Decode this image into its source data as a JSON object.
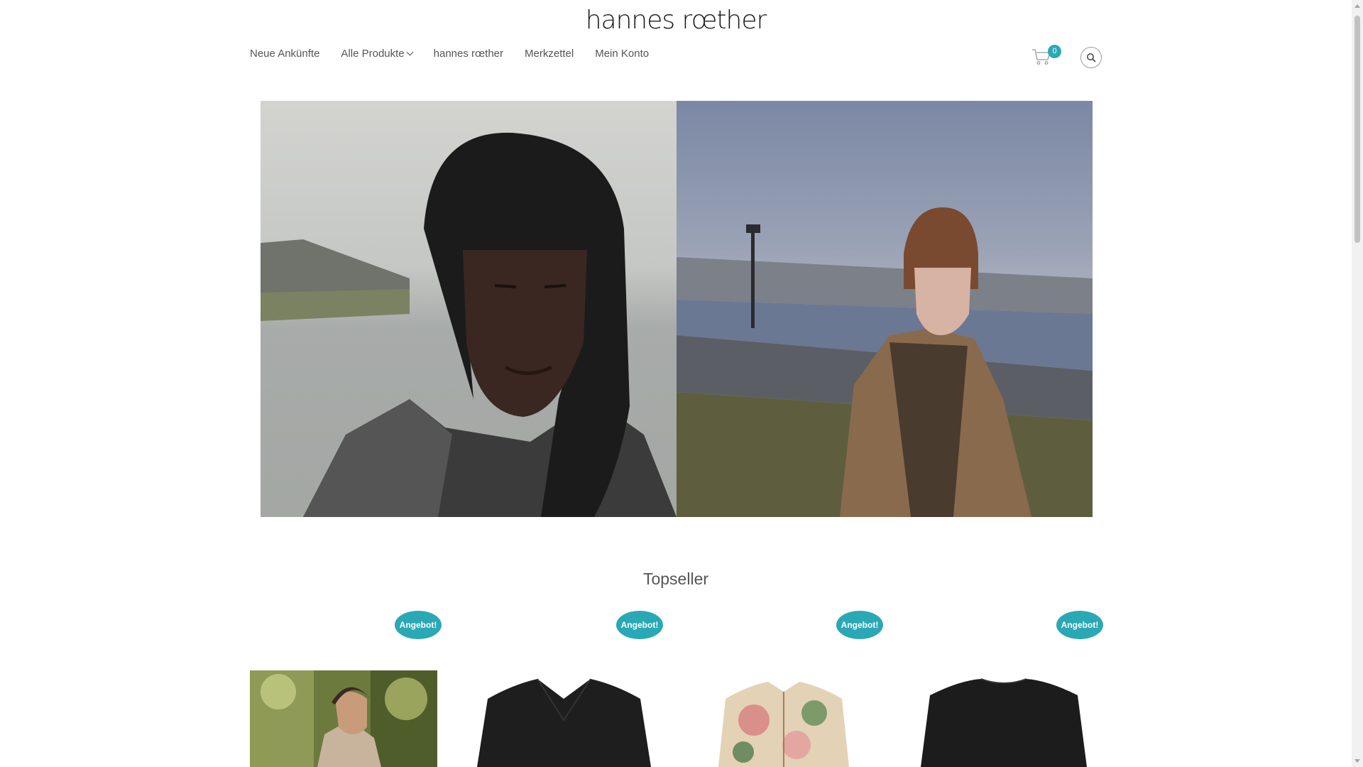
{
  "header": {
    "logo_text": "hannes rœther",
    "nav": [
      {
        "label": "Neue Ankünfte"
      },
      {
        "label": "Alle Produkte"
      },
      {
        "label": "hannes rœther"
      },
      {
        "label": "Merkzettel"
      },
      {
        "label": "Mein Konto"
      }
    ],
    "cart_count": "0",
    "icons": {
      "cart": "cart-icon",
      "search": "search-icon",
      "dropdown": "chevron-down-icon"
    }
  },
  "hero": {
    "images": [
      {
        "alt": "model in black knit beanie and tweed coat by the water"
      },
      {
        "alt": "model in crochet patchwork coat on a riverside path"
      }
    ]
  },
  "topseller": {
    "title": "Topseller",
    "products": [
      {
        "badge": "Angebot!",
        "image": "model in beige jacket in a forest"
      },
      {
        "badge": "Angebot!",
        "image": "black jacket"
      },
      {
        "badge": "Angebot!",
        "image": "floral print blouse"
      },
      {
        "badge": "Angebot!",
        "image": "black sweater"
      }
    ]
  },
  "colors": {
    "accent": "#2aa8b5",
    "text": "#555555"
  }
}
